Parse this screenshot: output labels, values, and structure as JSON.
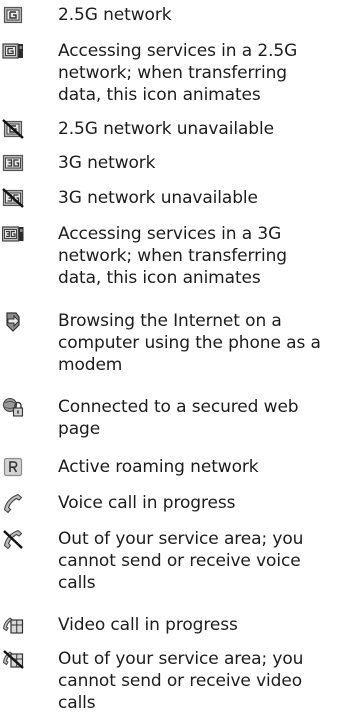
{
  "legend": {
    "items": [
      {
        "icon": "2-5g-network-icon",
        "text": "2.5G network"
      },
      {
        "icon": "2-5g-network-active-icon",
        "text": "Accessing services in a 2.5G\nnetwork; when transferring\ndata, this icon animates"
      },
      {
        "icon": "2-5g-network-unavailable-icon",
        "text": "2.5G network unavailable"
      },
      {
        "icon": "3g-network-icon",
        "text": "3G network"
      },
      {
        "icon": "3g-network-unavailable-icon",
        "text": "3G network unavailable"
      },
      {
        "icon": "3g-network-active-icon",
        "text": "Accessing services in a 3G\nnetwork; when transferring\ndata, this icon animates"
      },
      {
        "icon": "modem-browsing-icon",
        "text": "Browsing the Internet on a\ncomputer using the phone as a\nmodem"
      },
      {
        "icon": "secured-page-icon",
        "text": "Connected to a secured web\npage"
      },
      {
        "icon": "roaming-icon",
        "text": "Active roaming network"
      },
      {
        "icon": "voice-call-icon",
        "text": "Voice call in progress"
      },
      {
        "icon": "voice-call-unavailable-icon",
        "text": "Out of your service area; you\ncannot send or receive voice\ncalls"
      },
      {
        "icon": "video-call-icon",
        "text": "Video call in progress"
      },
      {
        "icon": "video-call-unavailable-icon",
        "text": "Out of your service area; you\ncannot send or receive video\ncalls"
      }
    ]
  }
}
